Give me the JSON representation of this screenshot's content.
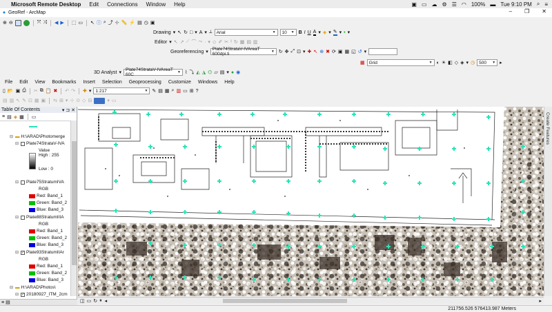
{
  "mac_menu": {
    "app_name": "Microsoft Remote Desktop",
    "items": [
      "Edit",
      "Connections",
      "Window",
      "Help"
    ],
    "battery": "100%",
    "clock": "Tue 9:10 PM"
  },
  "window": {
    "title": "GeoRef - ArcMap"
  },
  "drawing_toolbar": {
    "label": "Drawing",
    "font": "Arial",
    "font_size": "10",
    "bold": "B",
    "italic": "I",
    "underline": "U",
    "text_tool": "A"
  },
  "editor_toolbar": {
    "label": "Editor"
  },
  "georef_toolbar": {
    "label": "Georeferencing",
    "layer": "Plate74StrataV-IVAreaT 600dpi.ti"
  },
  "grid_toolbar": {
    "grid_combo": "Grid",
    "grid_value": "500"
  },
  "analyst_toolbar": {
    "label": "3D Analyst",
    "layer": "Plate74StrataV-IVAreaT 60C"
  },
  "app_menu": [
    "File",
    "Edit",
    "View",
    "Bookmarks",
    "Insert",
    "Selection",
    "Geoprocessing",
    "Customize",
    "Windows",
    "Help"
  ],
  "standard_toolbar": {
    "scale": "1:217"
  },
  "toc": {
    "title": "Table Of Contents",
    "folder1": "H:\\ARAD\\Photomerge",
    "layers": [
      {
        "name": "Plate74StrataV-IVA",
        "type": "stretched",
        "value_label": "Value",
        "high": "High : 255",
        "low": "Low : 0"
      },
      {
        "name": "Plate75StratumIVA",
        "type": "rgb",
        "rgb": "RGB",
        "bands": [
          "Red:   Band_1",
          "Green: Band_2",
          "Blue:  Band_3"
        ]
      },
      {
        "name": "Plate88StratumIIIA",
        "type": "rgb",
        "rgb": "RGB",
        "bands": [
          "Red:   Band_1",
          "Green: Band_2",
          "Blue:  Band_3"
        ]
      },
      {
        "name": "Plate93StratumIIAr",
        "type": "rgb",
        "rgb": "RGB",
        "bands": [
          "Red:   Band_1",
          "Green: Band_2",
          "Blue:  Band_3"
        ]
      }
    ],
    "folder2": "H:\\ARAD\\Photos\\",
    "layer_last": "20180927_ITM_2cm"
  },
  "side_panel": {
    "label": "Create Features"
  },
  "status_bar": {
    "coordinates": "211756.526  576413.987 Meters"
  },
  "colors": {
    "marker": "#29e3b8",
    "red_band": "#e00000",
    "green_band": "#00c000",
    "blue_band": "#0000e0",
    "highlight_combo": "#1a5fd0"
  }
}
